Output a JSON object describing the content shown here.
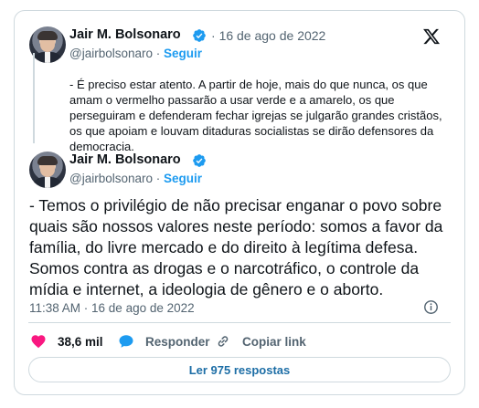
{
  "quoted_tweet": {
    "author_name": "Jair M. Bolsonaro",
    "date": "16 de ago de 2022",
    "handle": "@jairbolsonaro",
    "separator": "·",
    "follow_label": "Seguir",
    "text": "- É preciso estar atento. A partir de hoje, mais do que nunca, os que\namam o vermelho passarão a usar verde e a amarelo, os que\nperseguiram e defenderam fechar igrejas se julgarão grandes cristãos,\nos que apoiam e louvam ditaduras socialistas se dirão defensores da\ndemocracia."
  },
  "main_tweet": {
    "author_name": "Jair M. Bolsonaro",
    "handle": "@jairbolsonaro",
    "separator": "·",
    "follow_label": "Seguir",
    "text": "- Temos o privilégio de não precisar enganar o povo sobre\nquais são nossos valores neste período: somos a favor da\nfamília, do livre mercado e do direito à legítima defesa.\nSomos contra as drogas e o narcotráfico, o controle da\nmídia e internet, a ideologia de gênero e o aborto.",
    "timestamp": "11:38 AM · 16 de ago de 2022"
  },
  "actions": {
    "likes": "38,6 mil",
    "reply_label": "Responder",
    "copy_link_label": "Copiar link"
  },
  "replies_button_label": "Ler 975 respostas",
  "icons": {
    "logo": "x-logo-icon",
    "verified": "verified-badge-icon",
    "info": "info-icon",
    "like": "heart-icon",
    "reply": "speech-bubble-icon",
    "copy_link": "link-icon"
  },
  "colors": {
    "accent": "#1d9bf0",
    "like": "#f91880",
    "text": "#0f1419",
    "muted": "#536471",
    "border": "#cfd9de"
  }
}
